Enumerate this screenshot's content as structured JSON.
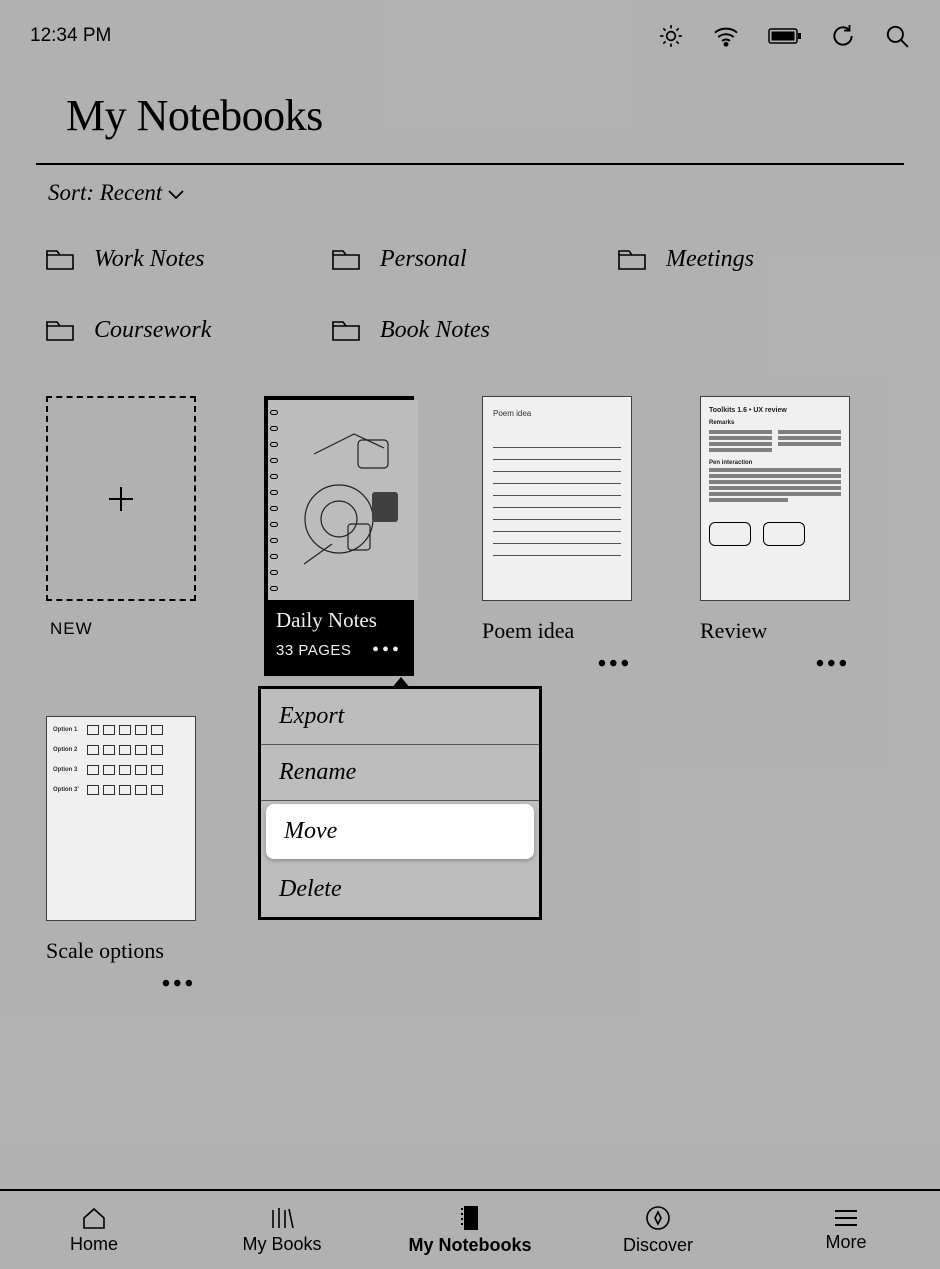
{
  "status": {
    "time": "12:34 PM"
  },
  "header": {
    "title": "My Notebooks"
  },
  "sort": {
    "label": "Sort: Recent"
  },
  "folders": [
    {
      "label": "Work Notes"
    },
    {
      "label": "Personal"
    },
    {
      "label": "Meetings"
    },
    {
      "label": "Coursework"
    },
    {
      "label": "Book Notes"
    }
  ],
  "new_label": "NEW",
  "notebooks": {
    "selected": {
      "title": "Daily Notes",
      "pages": "33 PAGES"
    },
    "n2": {
      "title": "Poem idea",
      "thumb_title": "Poem idea"
    },
    "n3": {
      "title": "Review",
      "thumb_title": "Toolkits 1.6 • UX review",
      "sec1": "Remarks",
      "sec2": "Pen interaction"
    },
    "n4": {
      "title": "Scale options",
      "opt1": "Option 1",
      "opt2": "Option 2",
      "opt3": "Option 3",
      "opt4": "Option 3'"
    }
  },
  "menu": [
    {
      "label": "Export"
    },
    {
      "label": "Rename"
    },
    {
      "label": "Move"
    },
    {
      "label": "Delete"
    }
  ],
  "bottom": [
    {
      "label": "Home"
    },
    {
      "label": "My Books"
    },
    {
      "label": "My Notebooks"
    },
    {
      "label": "Discover"
    },
    {
      "label": "More"
    }
  ]
}
